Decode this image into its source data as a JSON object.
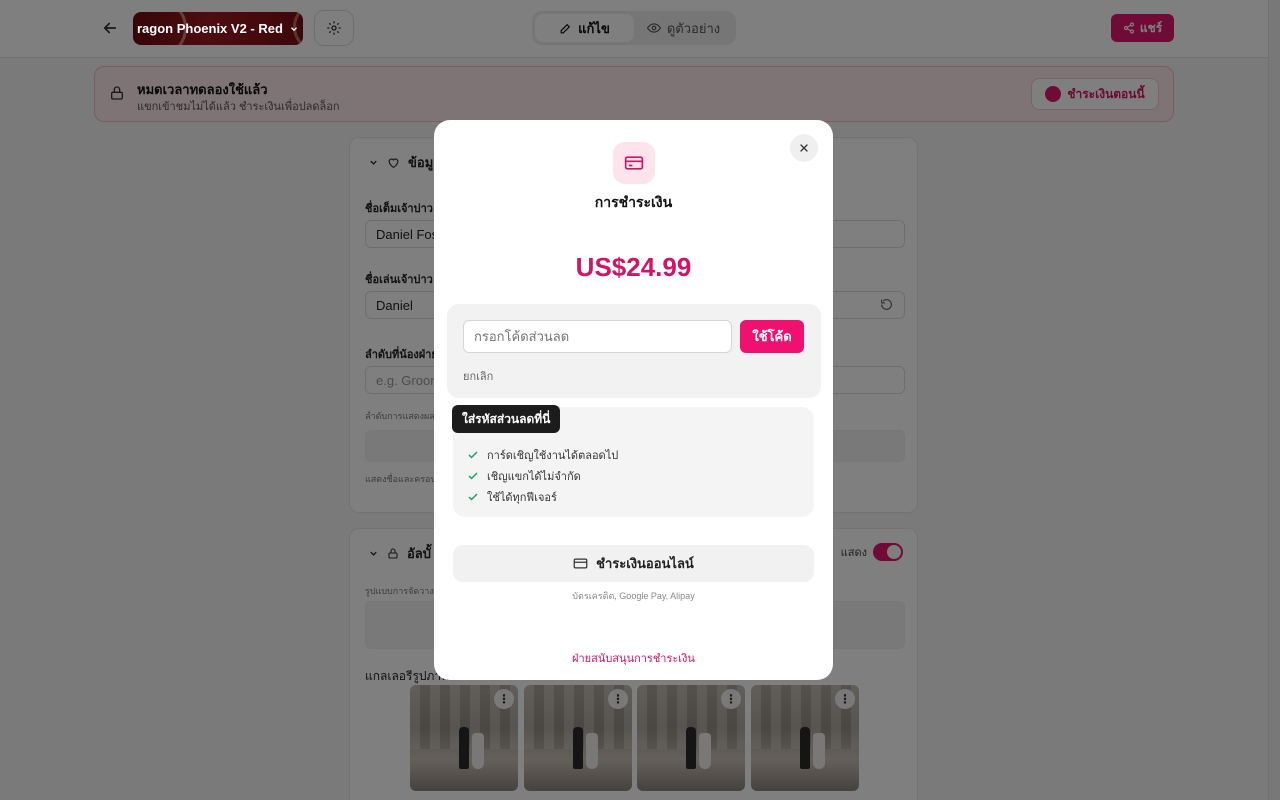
{
  "topbar": {
    "theme_name": "ragon Phoenix V2 - Red",
    "modes": [
      {
        "label": "แก้ไข",
        "active": true
      },
      {
        "label": "ดูตัวอย่าง",
        "active": false
      }
    ],
    "share_label": "แชร์"
  },
  "trial_banner": {
    "title": "หมดเวลาทดลองใช้แล้ว",
    "subtitle": "แขกเข้าชมไม่ได้แล้ว ชำระเงินเพื่อปลดล็อก",
    "pay_now_label": "ชำระเงินตอนนี้"
  },
  "form": {
    "section1_title": "ข้อมู",
    "groom_fullname_label": "ชื่อเต็มเจ้าบ่าว",
    "groom_fullname_value": "Daniel Fos",
    "groom_nickname_label": "ชื่อเล่นเจ้าบ่าว",
    "groom_nickname_value": "Daniel",
    "sibling_order_label": "ลำดับที่น้องฝ่าย",
    "sibling_order_placeholder": "e.g. Groom",
    "sibling_order_hint": "ลำดับการแสดงผล",
    "names_hint": "แสดงชื่อและครอบ",
    "section2_title": "อัลบั้",
    "show_label": "แสดง",
    "layout_hint": "รูปแบบการจัดวาง",
    "gallery_label": "แกลเลอรีรูปภาพ"
  },
  "modal": {
    "title": "การชำระเงิน",
    "price": "US$24.99",
    "coupon_placeholder": "กรอกโค้ดส่วนลด",
    "apply_label": "ใช้โค้ด",
    "cancel_label": "ยกเลิก",
    "tooltip": "ใส่รหัสส่วนลดที่นี่",
    "features": [
      "การ์ดเชิญใช้งานได้ตลอดไป",
      "เชิญแขกได้ไม่จำกัด",
      "ใช้ได้ทุกฟีเจอร์"
    ],
    "online_pay_label": "ชำระเงินออนไลน์",
    "methods": "บัตรเครดิต, Google Pay, Alipay",
    "support_label": "ฝ่ายสนับสนุนการชำระเงิน"
  },
  "colors": {
    "accent": "#e0176f",
    "price": "#d01468",
    "check": "#22a06b"
  }
}
